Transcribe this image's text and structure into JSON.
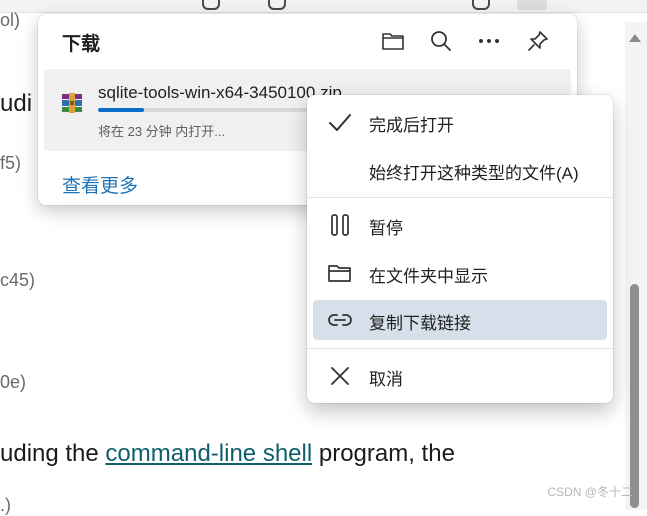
{
  "background_page": {
    "fragments": [
      "ol)",
      "udi",
      "f5)",
      "c45)",
      "0e)"
    ],
    "sentence_prefix": "uding the ",
    "sentence_link": "command-line shell",
    "sentence_suffix": " program, the",
    "bottom_fragment": ".)"
  },
  "downloads": {
    "title": "下载",
    "header_icons": [
      "folder-icon",
      "search-icon",
      "more-icon",
      "pin-icon"
    ],
    "item": {
      "file_name": "sqlite-tools-win-x64-3450100.zip",
      "status": "将在 23 分钟 内打开...",
      "progress": 0.22,
      "icon": "archive-icon"
    },
    "see_more": "查看更多"
  },
  "context_menu": {
    "items": [
      {
        "label": "完成后打开",
        "icon": "check-icon"
      },
      {
        "label": "始终打开这种类型的文件(A)",
        "icon": ""
      },
      {
        "label": "暂停",
        "icon": "pause-icon"
      },
      {
        "label": "在文件夹中显示",
        "icon": "folder-icon"
      },
      {
        "label": "复制下载链接",
        "icon": "link-icon"
      },
      {
        "label": "取消",
        "icon": "close-icon"
      }
    ]
  },
  "watermark": "CSDN @冬十二",
  "colors": {
    "accent": "#0a6ec7",
    "link": "#1f74b8",
    "highlight": "#d5e0ea"
  }
}
